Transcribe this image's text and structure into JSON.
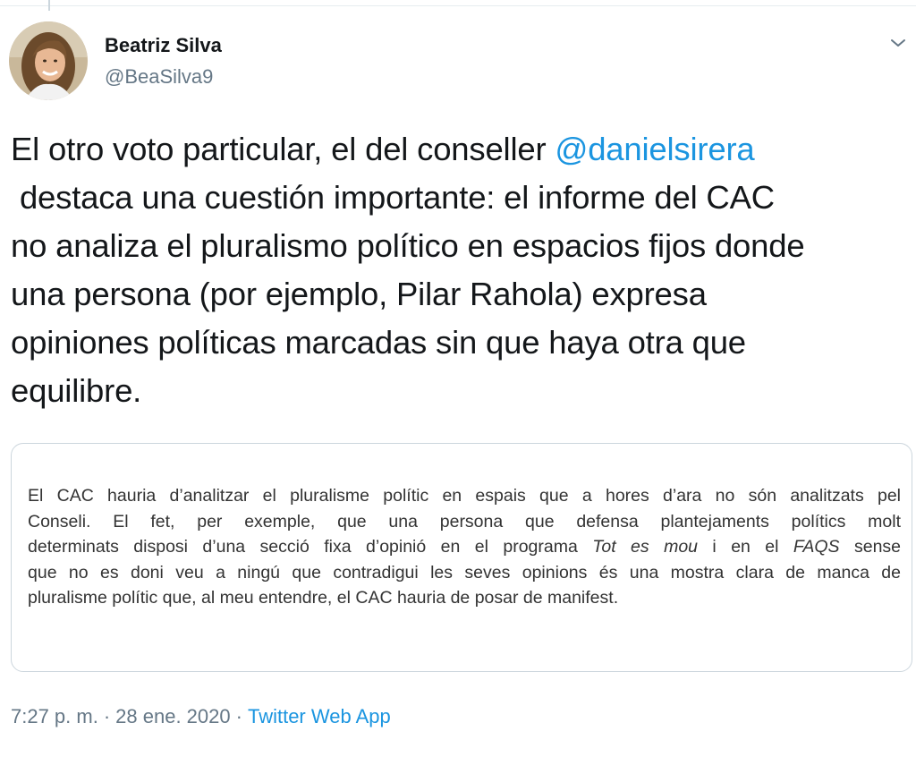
{
  "author": {
    "display_name": "Beatriz Silva",
    "handle": "@BeaSilva9"
  },
  "tweet": {
    "lines": [
      [
        "El otro voto particular, el del conseller ",
        "@danielsirera"
      ],
      [
        " destaca una cuestión importante: el informe del CAC"
      ],
      [
        "no analiza el pluralismo político en espacios fijos donde"
      ],
      [
        "una persona (por ejemplo, Pilar Rahola) expresa"
      ],
      [
        "opiniones políticas marcadas sin que haya otra que"
      ],
      [
        "equilibre."
      ]
    ]
  },
  "media": {
    "line1": "El CAC hauria d’analitzar el pluralisme polític en espais que a hores d’ara no són analitzats pel",
    "line2": "Conseli. El fet, per exemple, que una persona que defensa plantejaments polítics molt",
    "line3a": "determinats disposi d’una secció fixa d’opinió en el programa ",
    "line3b": "Tot es mou",
    "line3c": " i en el ",
    "line3d": "FAQS",
    "line3e": " sense",
    "line4": "que no es doni veu a ningú que contradigui les seves opinions és una mostra clara de manca de",
    "line5": "pluralisme polític que, al meu entendre, el CAC hauria de posar de manifest."
  },
  "meta": {
    "time": "7:27 p. m.",
    "separator": "·",
    "date": "28 ene. 2020",
    "source": "Twitter Web App"
  },
  "icons": {
    "caret": "chevron-down-icon"
  },
  "colors": {
    "link": "#1b95e0",
    "secondary": "#657786",
    "text": "#14171a",
    "border": "#ccd6dd"
  }
}
